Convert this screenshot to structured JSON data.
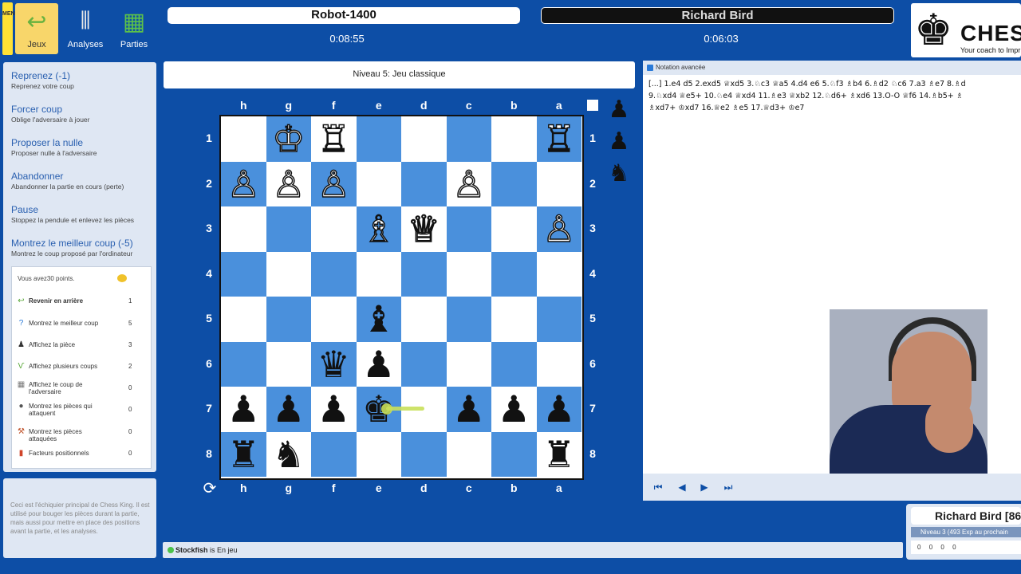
{
  "toolbar": {
    "menu_label": "MENU",
    "jeux": "Jeux",
    "analyses": "Analyses",
    "parties": "Parties"
  },
  "players": {
    "top": {
      "name": "Robot-1400",
      "clock": "0:08:55"
    },
    "bottom": {
      "name": "Richard Bird",
      "clock": "0:06:03"
    }
  },
  "logo": {
    "title": "CHESS",
    "tagline": "Your coach to Impr"
  },
  "left": {
    "actions": [
      {
        "title": "Reprenez (-1)",
        "desc": "Reprenez votre coup"
      },
      {
        "title": "Forcer coup",
        "desc": "Oblige l'adversaire à jouer"
      },
      {
        "title": "Proposer la nulle",
        "desc": "Proposer nulle à l'adversaire"
      },
      {
        "title": "Abandonner",
        "desc": "Abandonner la partie en cours (perte)"
      },
      {
        "title": "Pause",
        "desc": "Stoppez la pendule et enlevez les pièces"
      },
      {
        "title": "Montrez le meilleur coup (-5)",
        "desc": "Montrez le coup proposé par l'ordinateur"
      }
    ],
    "points_title": "Vous avez30 points.",
    "points": [
      {
        "label": "Revenir en arrière",
        "value": "1",
        "icon": "undo-icon"
      },
      {
        "label": "Montrez le meilleur coup",
        "value": "5",
        "icon": "question-icon"
      },
      {
        "label": "Affichez la pièce",
        "value": "3",
        "icon": "pawn-icon"
      },
      {
        "label": "Affichez plusieurs coups",
        "value": "2",
        "icon": "branch-icon"
      },
      {
        "label": "Affichez le coup de l'adversaire",
        "value": "0",
        "icon": "grid-icon"
      },
      {
        "label": "Montrez les pièces qui attaquent",
        "value": "0",
        "icon": "bomb-icon"
      },
      {
        "label": "Montrez les pièces attaquées",
        "value": "0",
        "icon": "hammer-icon"
      },
      {
        "label": "Facteurs positionnels",
        "value": "0",
        "icon": "bars-icon"
      }
    ],
    "info": "Ceci est l'échiquier principal de Chess King. Il est utilisé pour bouger les pièces durant la partie, mais aussi pour mettre en place des positions avant la partie, et les analyses."
  },
  "level": "Niveau 5: Jeu classique",
  "files": [
    "h",
    "g",
    "f",
    "e",
    "d",
    "c",
    "b",
    "a"
  ],
  "ranks": [
    "1",
    "2",
    "3",
    "4",
    "5",
    "6",
    "7",
    "8"
  ],
  "pieces": {
    "0": {
      "1": "♔",
      "2": "♖",
      "7": "♖"
    },
    "1": {
      "0": "♙",
      "1": "♙",
      "2": "♙",
      "5": "♙"
    },
    "2": {
      "3": "♗",
      "4": "♕",
      "7": "♙"
    },
    "4": {
      "3": "♝"
    },
    "5": {
      "2": "♛",
      "3": "♟"
    },
    "6": {
      "0": "♟",
      "1": "♟",
      "2": "♟",
      "3": "♚",
      "5": "♟",
      "6": "♟",
      "7": "♟"
    },
    "7": {
      "0": "♜",
      "1": "♞",
      "7": "♜"
    }
  },
  "captured": [
    "♟",
    "♟",
    "♞"
  ],
  "status": {
    "engine": "Stockfish",
    "text": " is En jeu"
  },
  "notation": {
    "header": "Notation avancée",
    "moves": "[...] 1.e4 d5 2.exd5 ♕xd5 3.♘c3 ♕a5 4.d4 e6 5.♘f3 ♗b4 6.♗d2 ♘c6 7.a3 ♗e7 8.♗d\n9.♘xd4 ♕e5+ 10.♘e4 ♕xd4 11.♗e3 ♕xb2 12.♘d6+ ♗xd6 13.O-O ♕f6 14.♗b5+ ♗\n♗xd7+ ♔xd7 16.♕e2 ♗e5 17.♕d3+ ♔e7"
  },
  "profile": {
    "name": "Richard Bird [86",
    "level": "Niveau 3 (493 Exp au prochain",
    "stats": [
      "0",
      "0",
      "0",
      "0"
    ]
  }
}
